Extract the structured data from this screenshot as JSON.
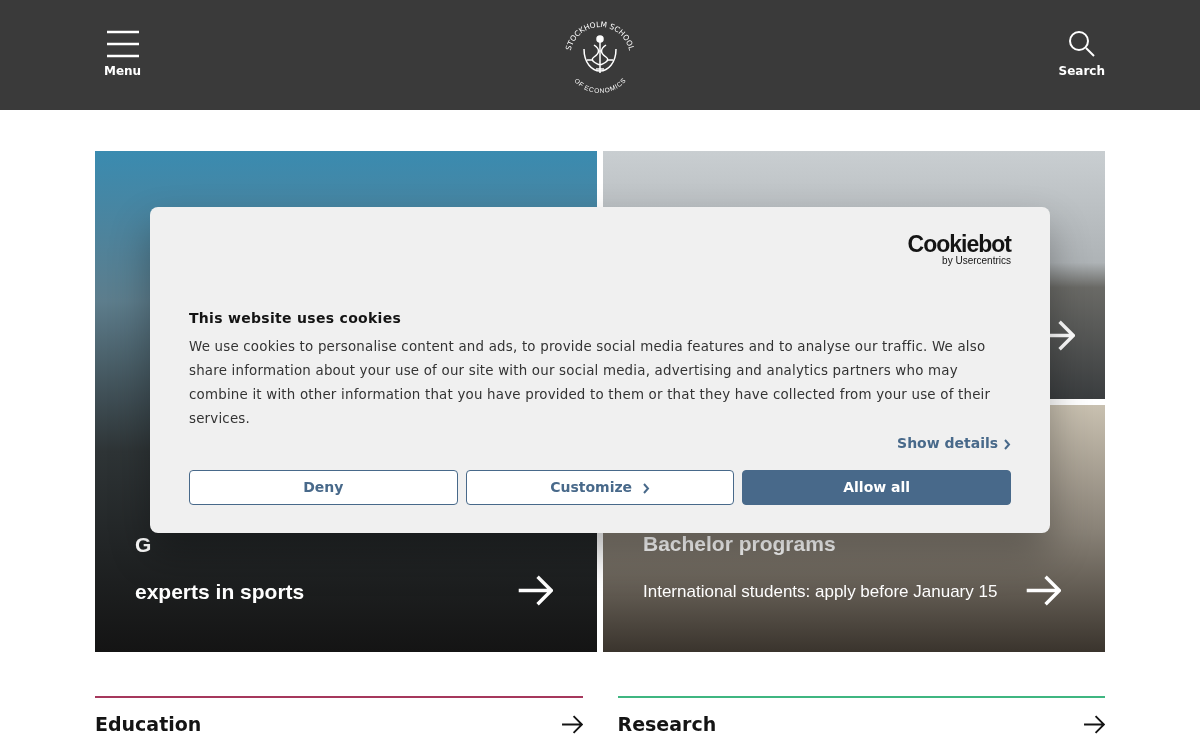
{
  "header": {
    "menu_label": "Menu",
    "search_label": "Search",
    "logo_top": "STOCKHOLM SCHOOL",
    "logo_bottom": "OF ECONOMICS"
  },
  "tiles": [
    {
      "title_lines": [
        "G",
        "experts in sports"
      ],
      "arrow": true
    },
    {
      "arrow": true
    },
    {
      "arrow": true,
      "title_lines": [
        "Bachelor programs"
      ],
      "subtitle": "International students: apply before January 15"
    }
  ],
  "cookie_dialog": {
    "brand": "Cookiebot",
    "brand_sub": "by Usercentrics",
    "title": "This website uses cookies",
    "body": "We use cookies to personalise content and ads, to provide social media features and to analyse our traffic. We also share information about your use of our site with our social media, advertising and analytics partners who may combine it with other information that you have provided to them or that they have collected from your use of their services.",
    "details_link": "Show details",
    "buttons": [
      {
        "label": "Deny",
        "kind": "outline"
      },
      {
        "label": "Customize",
        "kind": "outline-chevron"
      },
      {
        "label": "Allow all",
        "kind": "filled"
      }
    ]
  },
  "sections": [
    {
      "label": "Education",
      "color": "#a6385c"
    },
    {
      "label": "Research",
      "color": "#3fb681"
    }
  ]
}
